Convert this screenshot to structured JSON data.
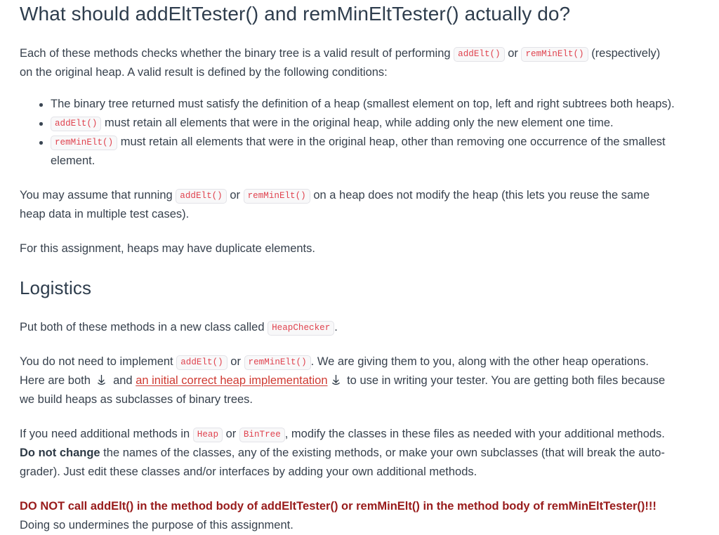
{
  "colors": {
    "heading": "#2e3d4d",
    "body_text": "#37414d",
    "inline_code_text": "#e0434f",
    "inline_code_bg": "#f8f8f9",
    "inline_code_border": "#e3e3e8",
    "link": "#cf3a32",
    "warning": "#981b1b",
    "background": "#ffffff",
    "bullet": "#3a4653"
  },
  "doc": {
    "title": "What should addEltTester() and remMinEltTester() actually do?",
    "intro": {
      "part1": "Each of these methods checks whether the binary tree is a valid result of performing ",
      "code1": "addElt()",
      "part2": " or ",
      "code2": "remMinElt()",
      "part3": " (respectively) on the original heap. A valid result is defined by the following conditions:"
    },
    "bullets": [
      {
        "text_before": "",
        "code": "",
        "text_after": "The binary tree returned must satisfy the definition of a heap (smallest element on top, left and right subtrees both heaps)."
      },
      {
        "text_before": "",
        "code": "addElt()",
        "text_after": " must retain all elements that were in the original heap, while adding only the new element one time."
      },
      {
        "text_before": "",
        "code": "remMinElt()",
        "text_after": " must retain all elements that were in the original heap, other than removing one occurrence of the smallest element."
      }
    ],
    "assume_para": {
      "part1": "You may assume that running ",
      "code1": "addElt()",
      "part2": " or ",
      "code2": "remMinElt()",
      "part3": " on a heap does not modify the heap (this lets you reuse the same heap data in multiple test cases)."
    },
    "duplicates_para": "For this assignment, heaps may have duplicate elements.",
    "logistics": {
      "heading": "Logistics",
      "put_para": {
        "part1": "Put both of these methods in a new class called ",
        "code1": "HeapChecker",
        "part2": "."
      },
      "implement_para": {
        "part1": "You do not need to implement ",
        "code1": "addElt()",
        "part2": " or ",
        "code2": "remMinElt()",
        "part3": ". We are giving them to you, along with the other heap operations. Here are both ",
        "icon1": "download-icon",
        "part4": " and ",
        "link_text": "an initial correct heap implementation",
        "icon2": "download-icon",
        "part5": " to use in writing your tester. You are getting both files because we build heaps as subclasses of binary trees."
      },
      "additional_para": {
        "part1": "If you need additional methods in ",
        "code1": "Heap",
        "part2": " or ",
        "code2": "BinTree",
        "part3": ", modify the classes in these files as needed with your additional methods. ",
        "bold1": "Do not change",
        "part4": " the names of the classes, any of the existing methods, or make your own subclasses (that will break the auto-grader). Just edit these classes and/or interfaces by adding your own additional methods."
      },
      "warning_para": {
        "strong": "DO NOT call addElt() in the method body of addEltTester() or remMinElt() in the method body of remMinEltTester()!!!",
        "rest": " Doing so undermines the purpose of this assignment."
      }
    }
  }
}
